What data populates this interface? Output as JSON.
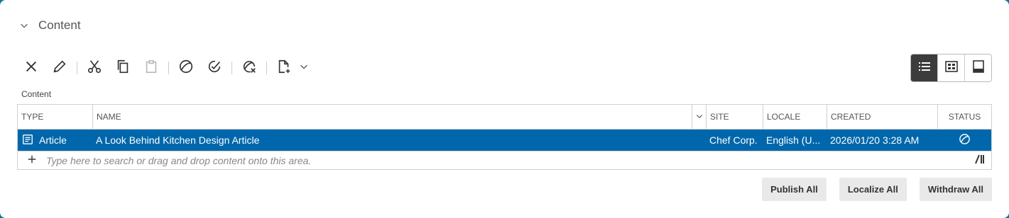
{
  "section": {
    "title": "Content"
  },
  "toolbar": {
    "icons": [
      "close-icon",
      "pencil-icon",
      "scissors-icon",
      "copy-icon",
      "paste-icon",
      "publish-icon",
      "approve-icon",
      "withdraw-icon",
      "new-content-icon",
      "chevron-down-icon"
    ]
  },
  "view_modes": {
    "active": "list",
    "modes": [
      "list",
      "thumbnails",
      "preview"
    ]
  },
  "grid": {
    "label": "Content",
    "columns": {
      "type": "TYPE",
      "name": "NAME",
      "site": "SITE",
      "locale": "LOCALE",
      "created": "CREATED",
      "status": "STATUS"
    },
    "rows": [
      {
        "type": "Article",
        "name": "A Look Behind Kitchen Design Article",
        "site": "Chef Corp.",
        "locale": "English (U...",
        "created": "2026/01/20 3:28 AM",
        "status": "in-production-icon"
      }
    ],
    "add_placeholder": "Type here to search or drag and drop content onto this area."
  },
  "actions": {
    "publish_all": "Publish All",
    "localize_all": "Localize All",
    "withdraw_all": "Withdraw All"
  },
  "colors": {
    "selected_row": "#0067ac",
    "active_view": "#3c3c3c",
    "frame": "#0a7a94"
  }
}
